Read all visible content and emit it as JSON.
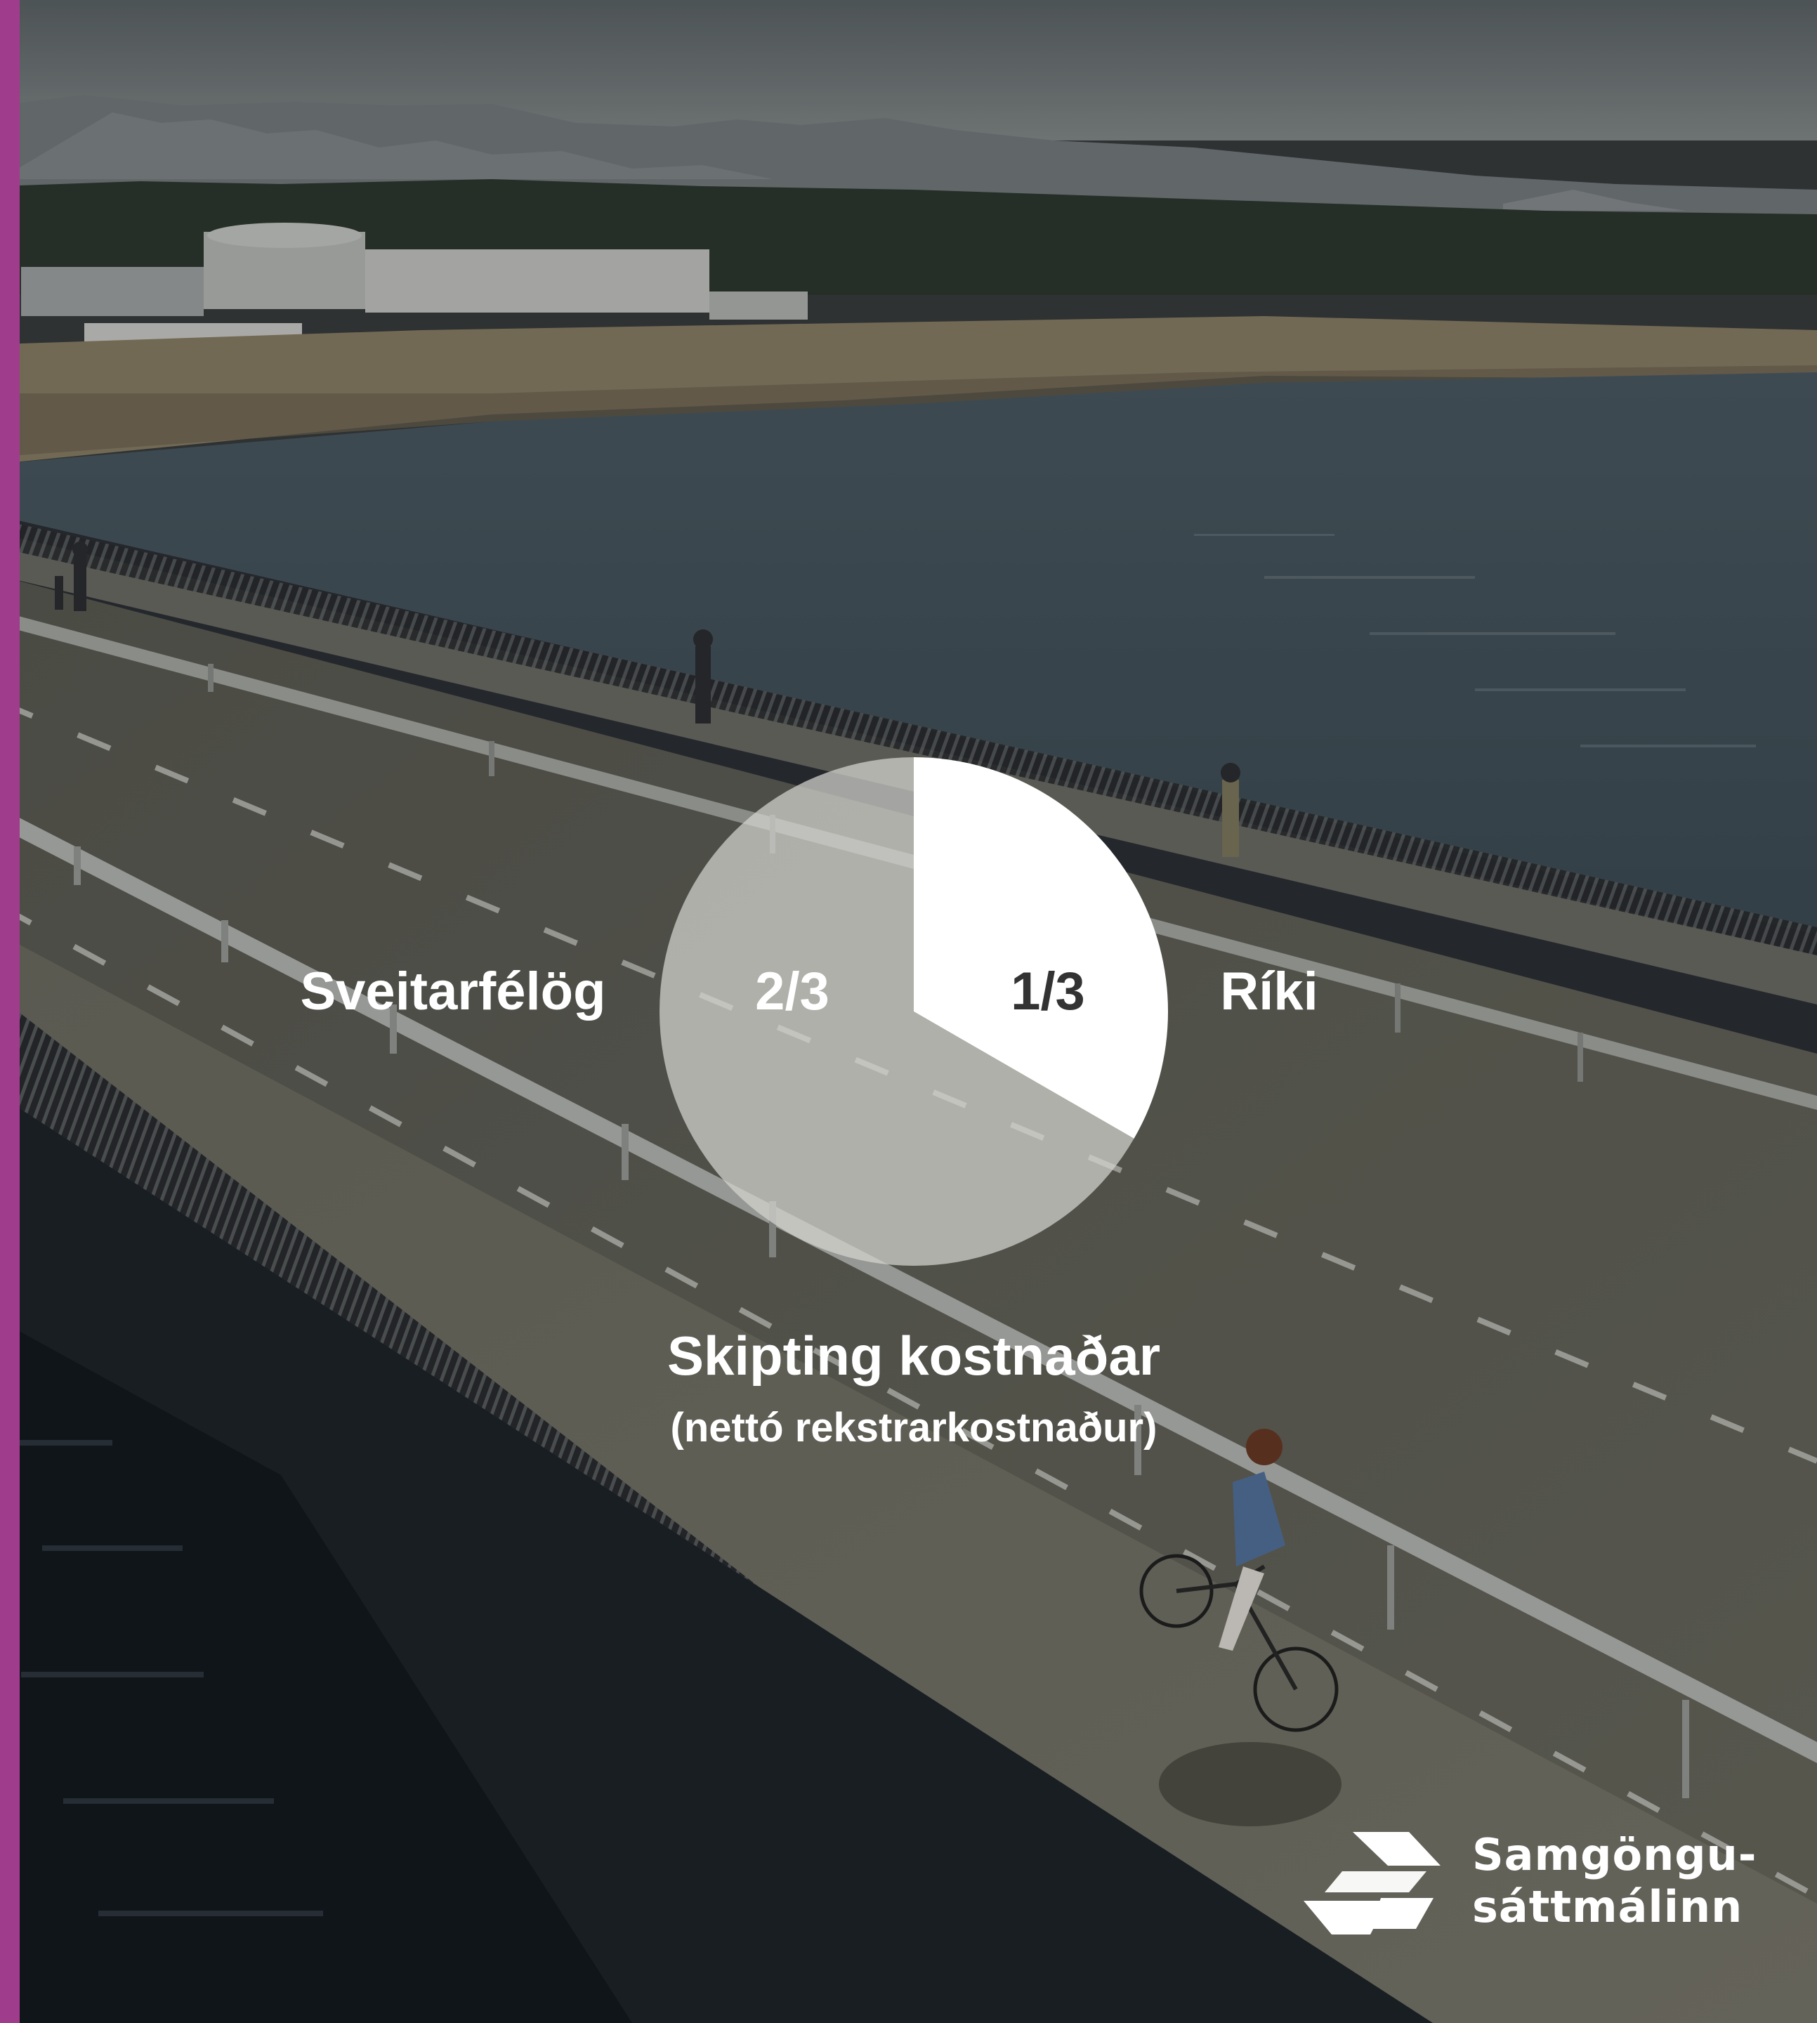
{
  "colors": {
    "accent": "#a03c8c",
    "pie_small": "#ffffff",
    "pie_large": "#d6d6d0",
    "text": "#ffffff"
  },
  "chart_data": {
    "type": "pie",
    "title": "Skipting kostnaðar",
    "subtitle": "(nettó rekstrarkostnaður)",
    "slices": [
      {
        "label": "Ríki",
        "value_label": "1/3",
        "fraction": 0.3333
      },
      {
        "label": "Sveitarfélög",
        "value_label": "2/3",
        "fraction": 0.6667
      }
    ]
  },
  "logo": {
    "icon": "samgongusattmalinn-logo-icon",
    "line1": "Samgöngu-",
    "line2": "sáttmálinn"
  }
}
